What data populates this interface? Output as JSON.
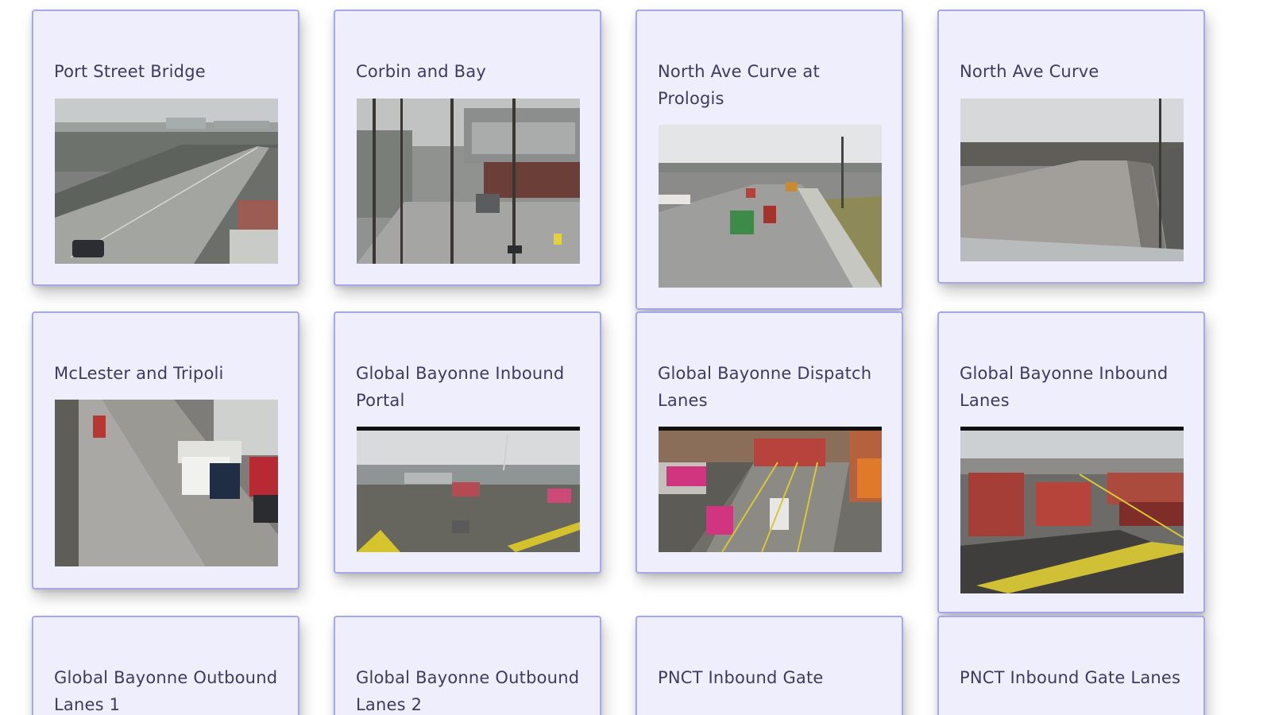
{
  "cameras": [
    {
      "title": "Port Street Bridge"
    },
    {
      "title": "Corbin and Bay"
    },
    {
      "title": "North Ave Curve at Prologis"
    },
    {
      "title": "North Ave Curve"
    },
    {
      "title": "McLester and Tripoli"
    },
    {
      "title": "Global Bayonne Inbound Portal"
    },
    {
      "title": "Global Bayonne Dispatch Lanes"
    },
    {
      "title": "Global Bayonne Inbound Lanes"
    },
    {
      "title": "Global Bayonne Outbound Lanes 1"
    },
    {
      "title": "Global Bayonne Outbound Lanes 2"
    },
    {
      "title": "PNCT Inbound Gate"
    },
    {
      "title": "PNCT Inbound Gate Lanes"
    }
  ]
}
